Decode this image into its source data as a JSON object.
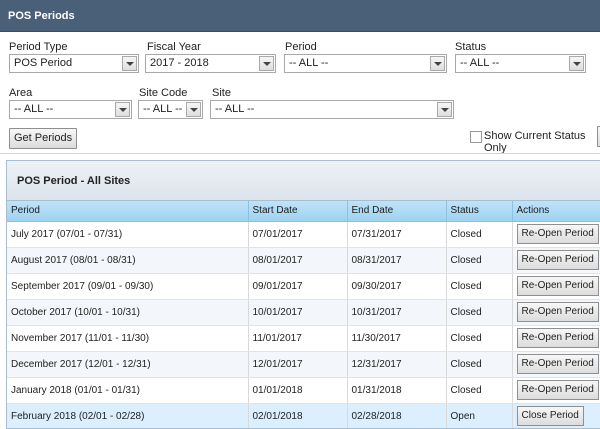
{
  "window": {
    "title": "POS Periods"
  },
  "filters": {
    "period_type": {
      "label": "Period Type",
      "value": "POS Period"
    },
    "fiscal_year": {
      "label": "Fiscal Year",
      "value": "2017 - 2018"
    },
    "period": {
      "label": "Period",
      "value": "-- ALL --"
    },
    "status": {
      "label": "Status",
      "value": "-- ALL --"
    },
    "area": {
      "label": "Area",
      "value": "-- ALL --"
    },
    "site_code": {
      "label": "Site Code",
      "value": "-- ALL --"
    },
    "site": {
      "label": "Site",
      "value": "-- ALL --"
    },
    "get_periods_label": "Get Periods",
    "show_current_status_label": "Show Current Status Only",
    "show_current_status_checked": false
  },
  "panel": {
    "title": "POS Period - All Sites",
    "columns": [
      "Period",
      "Start Date",
      "End Date",
      "Status",
      "Actions"
    ],
    "rows": [
      {
        "period": "July 2017 (07/01 - 07/31)",
        "start": "07/01/2017",
        "end": "07/31/2017",
        "status": "Closed",
        "action": "Re-Open Period"
      },
      {
        "period": "August 2017 (08/01 - 08/31)",
        "start": "08/01/2017",
        "end": "08/31/2017",
        "status": "Closed",
        "action": "Re-Open Period"
      },
      {
        "period": "September 2017 (09/01 - 09/30)",
        "start": "09/01/2017",
        "end": "09/30/2017",
        "status": "Closed",
        "action": "Re-Open Period"
      },
      {
        "period": "October 2017 (10/01 - 10/31)",
        "start": "10/01/2017",
        "end": "10/31/2017",
        "status": "Closed",
        "action": "Re-Open Period"
      },
      {
        "period": "November 2017 (11/01 - 11/30)",
        "start": "11/01/2017",
        "end": "11/30/2017",
        "status": "Closed",
        "action": "Re-Open Period"
      },
      {
        "period": "December 2017 (12/01 - 12/31)",
        "start": "12/01/2017",
        "end": "12/31/2017",
        "status": "Closed",
        "action": "Re-Open Period"
      },
      {
        "period": "January 2018 (01/01 - 01/31)",
        "start": "01/01/2018",
        "end": "01/31/2018",
        "status": "Closed",
        "action": "Re-Open Period"
      },
      {
        "period": "February 2018 (02/01 - 02/28)",
        "start": "02/01/2018",
        "end": "02/28/2018",
        "status": "Open",
        "action": "Close Period"
      }
    ]
  },
  "colors": {
    "titlebar": "#4a5f78",
    "header_row": "#9fd3f1",
    "selected_row": "#dcefff"
  }
}
